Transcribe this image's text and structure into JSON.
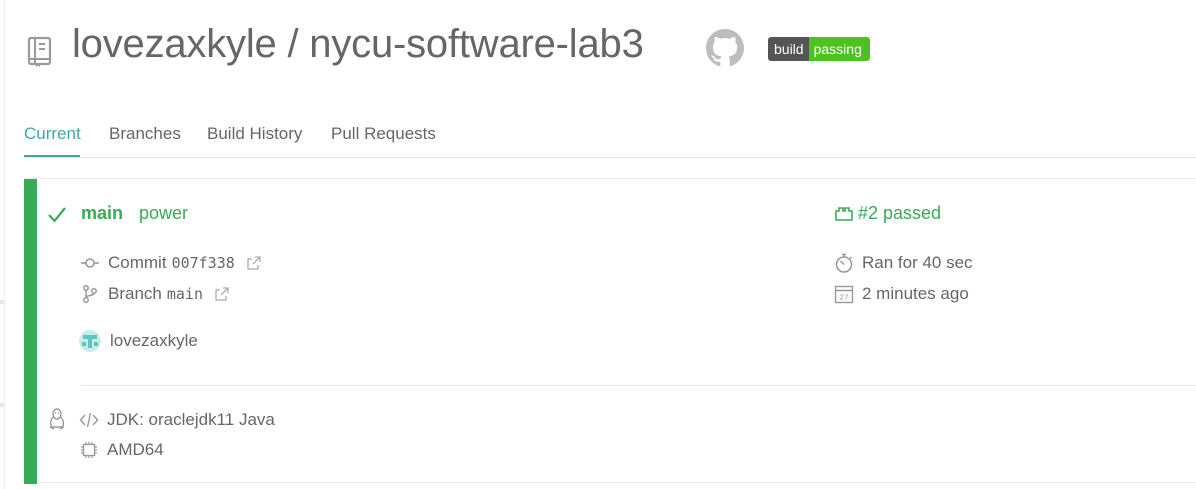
{
  "header": {
    "repo_title": "lovezaxkyle / nycu-software-lab3",
    "badge": {
      "left": "build",
      "right": "passing"
    }
  },
  "icons": {
    "repo": "repo-icon",
    "github": "github-icon",
    "check": "check-icon",
    "commit": "commit-icon",
    "branch": "branch-icon",
    "external_link": "external-link-icon",
    "build_number": "build-number-icon",
    "stopwatch": "stopwatch-icon",
    "calendar": "calendar-icon",
    "linux": "linux-icon",
    "code": "code-icon",
    "cpu": "cpu-icon"
  },
  "tabs": [
    {
      "label": "Current",
      "active": true
    },
    {
      "label": "Branches",
      "active": false
    },
    {
      "label": "Build History",
      "active": false
    },
    {
      "label": "Pull Requests",
      "active": false
    }
  ],
  "build": {
    "branch": "main",
    "message": "power",
    "commit_label": "Commit",
    "commit_sha": "007f338",
    "branch_label": "Branch",
    "branch_value": "main",
    "author": "lovezaxkyle",
    "status": "#2 passed",
    "duration": "Ran for 40 sec",
    "finished": "2 minutes ago",
    "calendar_day": "27",
    "jdk": "JDK: oraclejdk11 Java",
    "arch": "AMD64"
  },
  "colors": {
    "passed": "#39aa56",
    "tab_active": "#3aaaa4",
    "badge_left": "#555555",
    "badge_right": "#4dc31f",
    "text": "#666666"
  }
}
